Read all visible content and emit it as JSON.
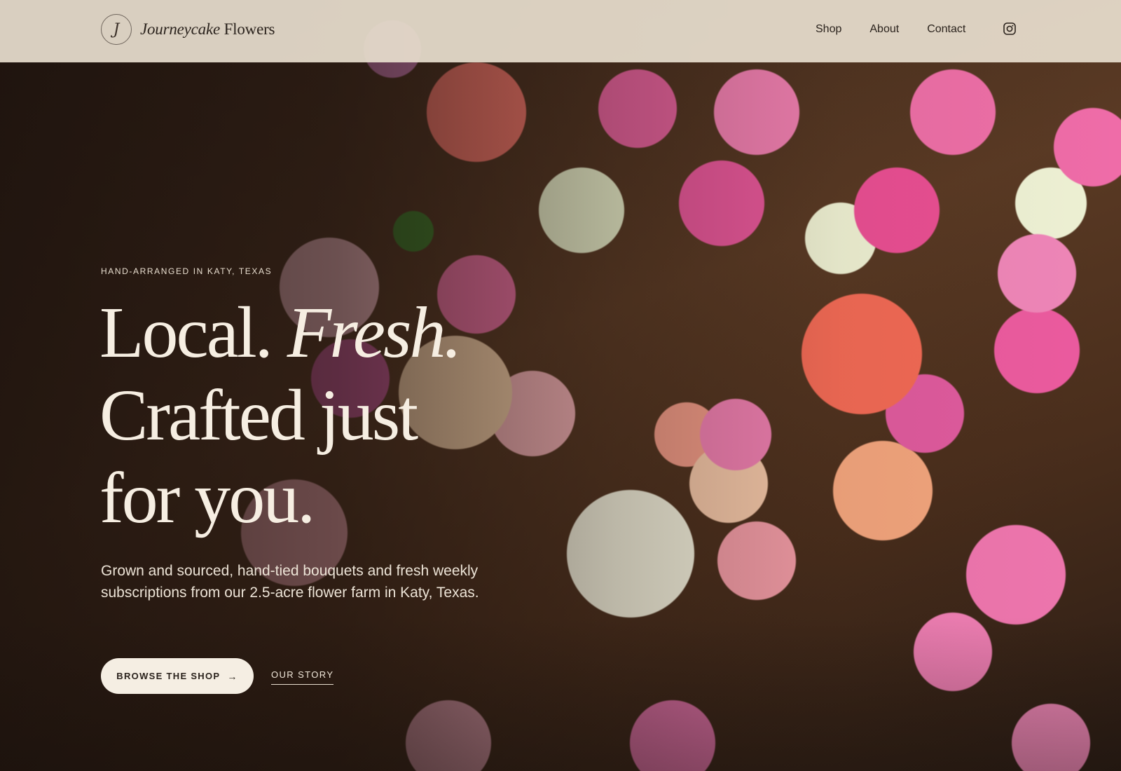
{
  "brand": {
    "mark": "J",
    "name_italic": "Journeycake",
    "name_regular": "Flowers"
  },
  "nav": {
    "items": [
      "Shop",
      "About",
      "Contact"
    ],
    "instagram_icon": "instagram-icon"
  },
  "hero": {
    "eyebrow": "HAND-ARRANGED IN KATY, TEXAS",
    "headline": {
      "line1_regular": "Local.",
      "line1_italic": "Fresh.",
      "line2": "Crafted just",
      "line3": "for you."
    },
    "subtitle": "Grown and sourced, hand-tied bouquets and fresh weekly subscriptions from our 2.5-acre flower farm in Katy, Texas.",
    "primary_button": "BROWSE THE SHOP",
    "primary_button_icon": "arrow-right-icon",
    "secondary_link": "OUR STORY"
  },
  "colors": {
    "header_bg": "#e7dece",
    "cream": "#f5eee3",
    "ink": "#2b231d"
  }
}
